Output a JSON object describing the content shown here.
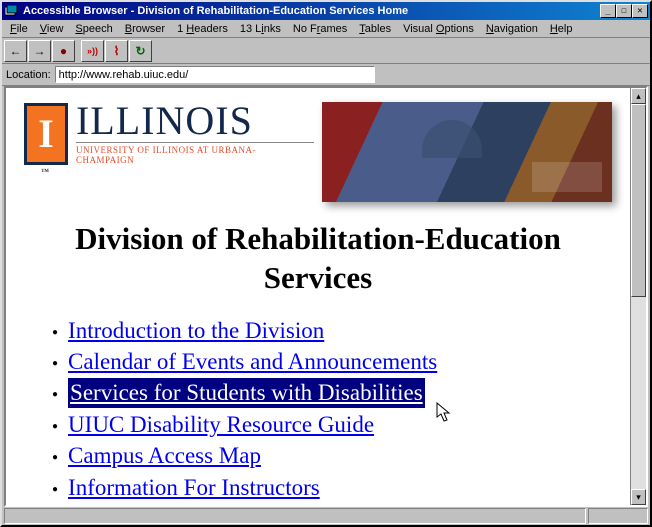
{
  "window": {
    "title": "Accessible Browser - Division of Rehabilitation-Education Services Home"
  },
  "menu": {
    "items": [
      {
        "key": "F",
        "rest": "ile"
      },
      {
        "key": "V",
        "rest": "iew"
      },
      {
        "key": "S",
        "rest": "peech"
      },
      {
        "key": "B",
        "rest": "rowser"
      },
      {
        "pre": "1 ",
        "key": "H",
        "rest": "eaders"
      },
      {
        "pre": "13 L",
        "key": "i",
        "rest": "nks"
      },
      {
        "pre": "No F",
        "key": "r",
        "rest": "ames"
      },
      {
        "key": "T",
        "rest": "ables"
      },
      {
        "pre": "Visual ",
        "key": "O",
        "rest": "ptions"
      },
      {
        "key": "N",
        "rest": "avigation"
      },
      {
        "key": "H",
        "rest": "elp"
      }
    ]
  },
  "toolbar": {
    "back": "←",
    "forward": "→",
    "stop": "●",
    "speak": "»))",
    "stop_speak": "⌇",
    "reload": "↻"
  },
  "location": {
    "label": "Location:",
    "url": "http://www.rehab.uiuc.edu/"
  },
  "logo": {
    "letter": "I",
    "word": "ILLINOIS",
    "sub": "UNIVERSITY OF ILLINOIS AT URBANA-CHAMPAIGN"
  },
  "page": {
    "title": "Division of Rehabilitation-Education Services",
    "links": [
      {
        "label": "Introduction to the Division",
        "hl": false
      },
      {
        "label": "Calendar of Events and Announcements",
        "hl": false
      },
      {
        "label": "Services for Students with Disabilities",
        "hl": true
      },
      {
        "label": "UIUC Disability Resource Guide",
        "hl": false
      },
      {
        "label": "Campus Access Map",
        "hl": false
      },
      {
        "label": "Information For Instructors",
        "hl": false
      }
    ]
  }
}
